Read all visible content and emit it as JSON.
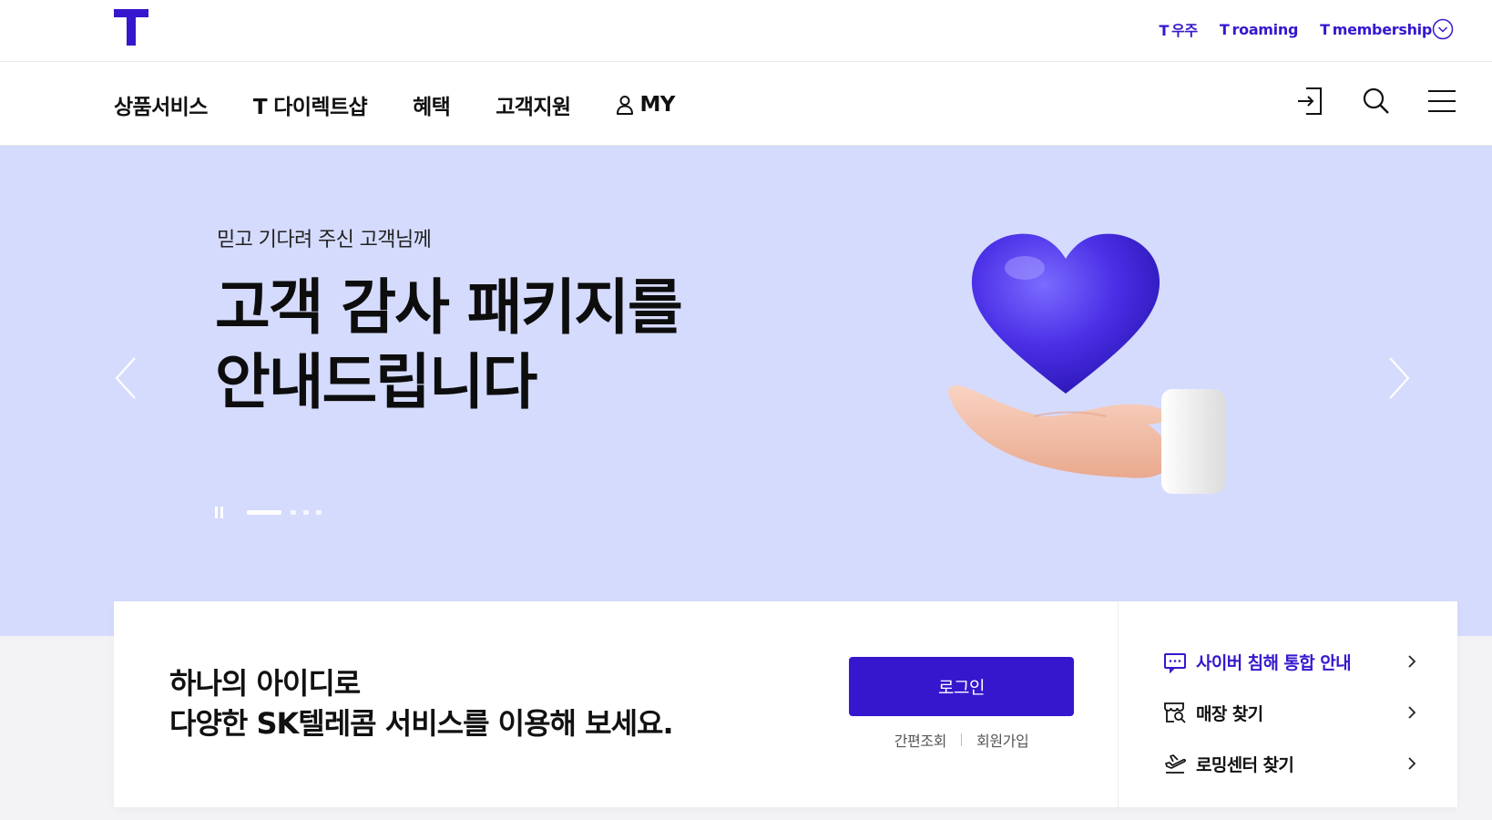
{
  "header": {
    "util_links": [
      {
        "prefix": "T",
        "label": "우주"
      },
      {
        "prefix": "T",
        "label": "roaming"
      },
      {
        "prefix": "T",
        "label": "membership"
      }
    ]
  },
  "gnb": {
    "menu": [
      {
        "label": "상품서비스"
      },
      {
        "label": "T 다이렉트샵"
      },
      {
        "label": "혜택"
      },
      {
        "label": "고객지원"
      },
      {
        "label": "MY"
      }
    ]
  },
  "hero": {
    "subtitle": "믿고 기다려 주신 고객님께",
    "title_line1": "고객 감사 패키지를",
    "title_line2": "안내드립니다",
    "slide_index": 1,
    "slide_count": 4
  },
  "login_card": {
    "message_line1": "하나의 아이디로",
    "message_line2": "다양한 SK텔레콤 서비스를 이용해 보세요.",
    "login_button": "로그인",
    "link_quick": "간편조회",
    "link_join": "회원가입"
  },
  "quick_links": [
    {
      "label": "사이버 침해 통합 안내",
      "icon": "notice-message-icon",
      "highlighted": true
    },
    {
      "label": "매장 찾기",
      "icon": "store-search-icon",
      "highlighted": false
    },
    {
      "label": "로밍센터 찾기",
      "icon": "airplane-icon",
      "highlighted": false
    }
  ],
  "colors": {
    "brand": "#3617ce",
    "hero_bg": "#d5dbfd"
  }
}
